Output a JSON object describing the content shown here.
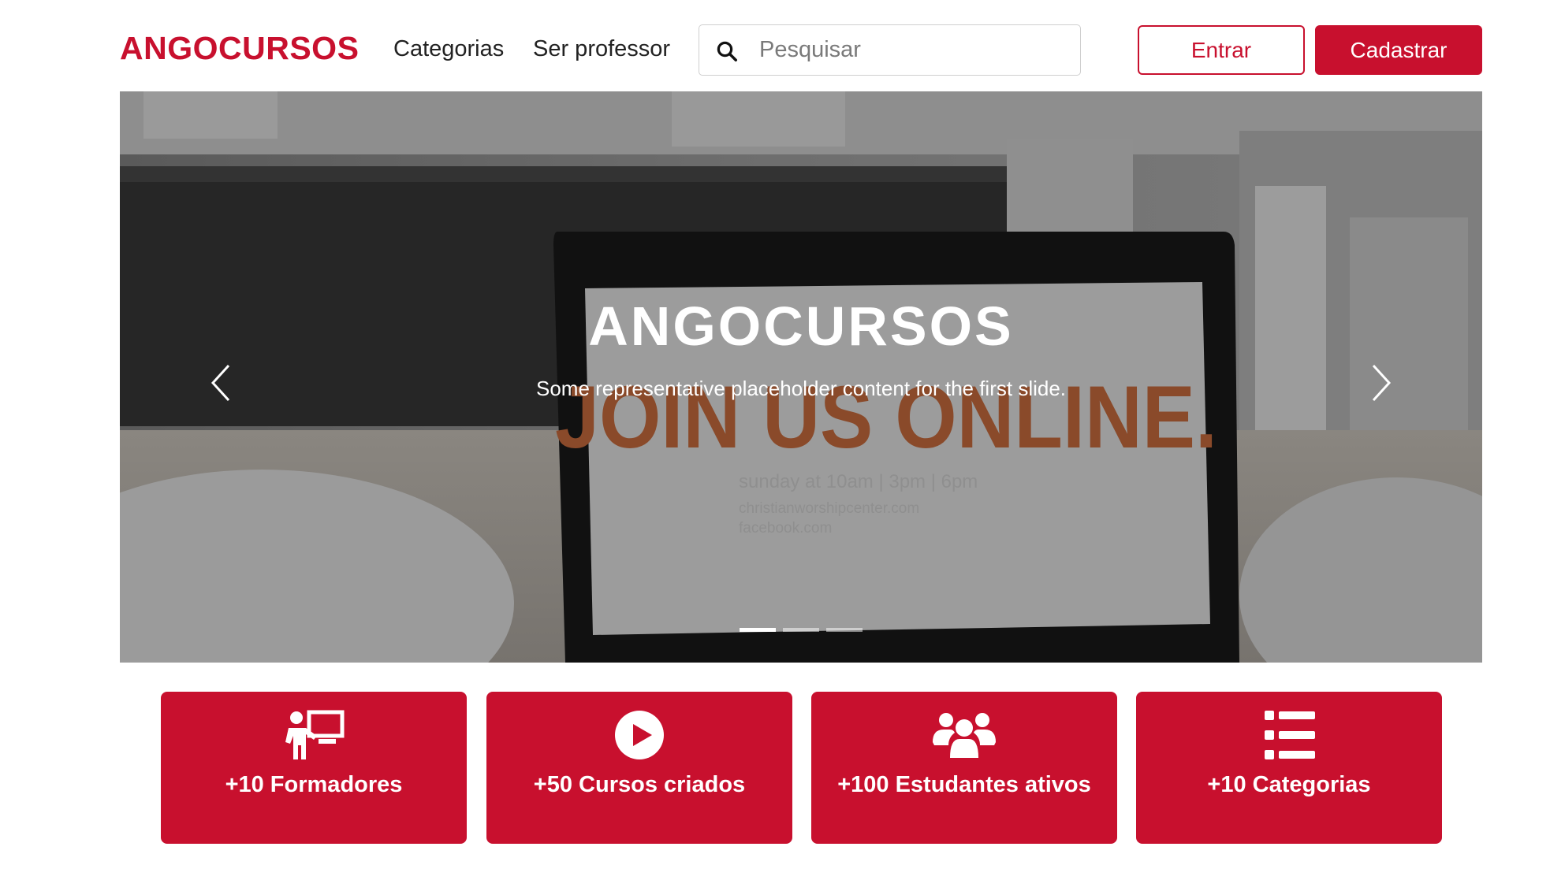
{
  "header": {
    "logo": "ANGOCURSOS",
    "nav": [
      {
        "label": "Categorias"
      },
      {
        "label": "Ser professor"
      }
    ],
    "search": {
      "placeholder": "Pesquisar",
      "value": "",
      "icon": "search-icon"
    },
    "buttons": {
      "login_label": "Entrar",
      "signup_label": "Cadastrar"
    }
  },
  "hero": {
    "title": "ANGOCURSOS",
    "caption": "Some representative placeholder content for the first slide.",
    "screen_text": {
      "headline": "JOIN US ONLINE.",
      "line1": "sunday at 10am | 3pm | 6pm",
      "line2": "christianworshipcenter.com",
      "line3": "facebook.com"
    },
    "slides_total": 3,
    "active_slide": 1,
    "prev_icon": "chevron-left-icon",
    "next_icon": "chevron-right-icon"
  },
  "stats": [
    {
      "label": "+10 Formadores",
      "icon": "teacher-board-icon"
    },
    {
      "label": "+50 Cursos criados",
      "icon": "play-circle-icon"
    },
    {
      "label": "+100 Estudantes ativos",
      "icon": "users-group-icon"
    },
    {
      "label": "+10 Categorias",
      "icon": "list-icon"
    }
  ],
  "colors": {
    "brand": "#c8102e",
    "text": "#222222",
    "placeholder": "#7a7a7a",
    "white": "#ffffff"
  }
}
